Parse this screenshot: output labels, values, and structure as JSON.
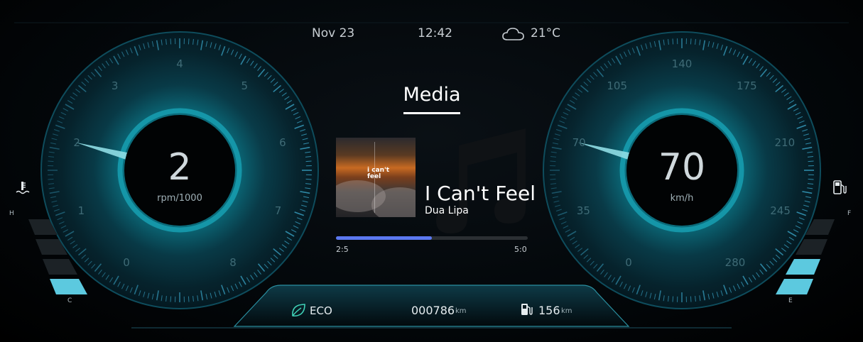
{
  "topbar": {
    "date": "Nov 23",
    "time": "12:42",
    "weather_icon": "cloud-icon",
    "temperature": "21°C"
  },
  "tachometer": {
    "value": "2",
    "unit": "rpm/1000",
    "ticks": [
      "0",
      "1",
      "2",
      "3",
      "4",
      "5",
      "6",
      "7",
      "8"
    ],
    "needle_value": 2,
    "max": 8
  },
  "speedometer": {
    "value": "70",
    "unit": "km/h",
    "ticks": [
      "0",
      "35",
      "70",
      "105",
      "140",
      "175",
      "210",
      "245",
      "280"
    ],
    "needle_value": 70,
    "max": 280
  },
  "media": {
    "heading": "Media",
    "album_text": "i can't feel",
    "song_title": "I Can't Feel",
    "artist": "Dua Lipa",
    "elapsed": "2:5",
    "total": "5:0",
    "progress": 0.5,
    "background_icon": "music-note-icon"
  },
  "bottom": {
    "mode": "ECO",
    "mode_icon": "leaf-icon",
    "odometer": "000786",
    "odometer_unit": "km",
    "range_icon": "fuel-pump-icon",
    "range": "156",
    "range_unit": "km"
  },
  "temperature_gauge": {
    "icon": "coolant-temperature-icon",
    "high_label": "H",
    "low_label": "C",
    "level": 0.25
  },
  "fuel_gauge": {
    "icon": "fuel-pump-icon",
    "full_label": "F",
    "empty_label": "E",
    "level": 0.5
  },
  "colors": {
    "accent": "#23b8c8",
    "progress": "#5b78f0",
    "background": "#000000"
  }
}
